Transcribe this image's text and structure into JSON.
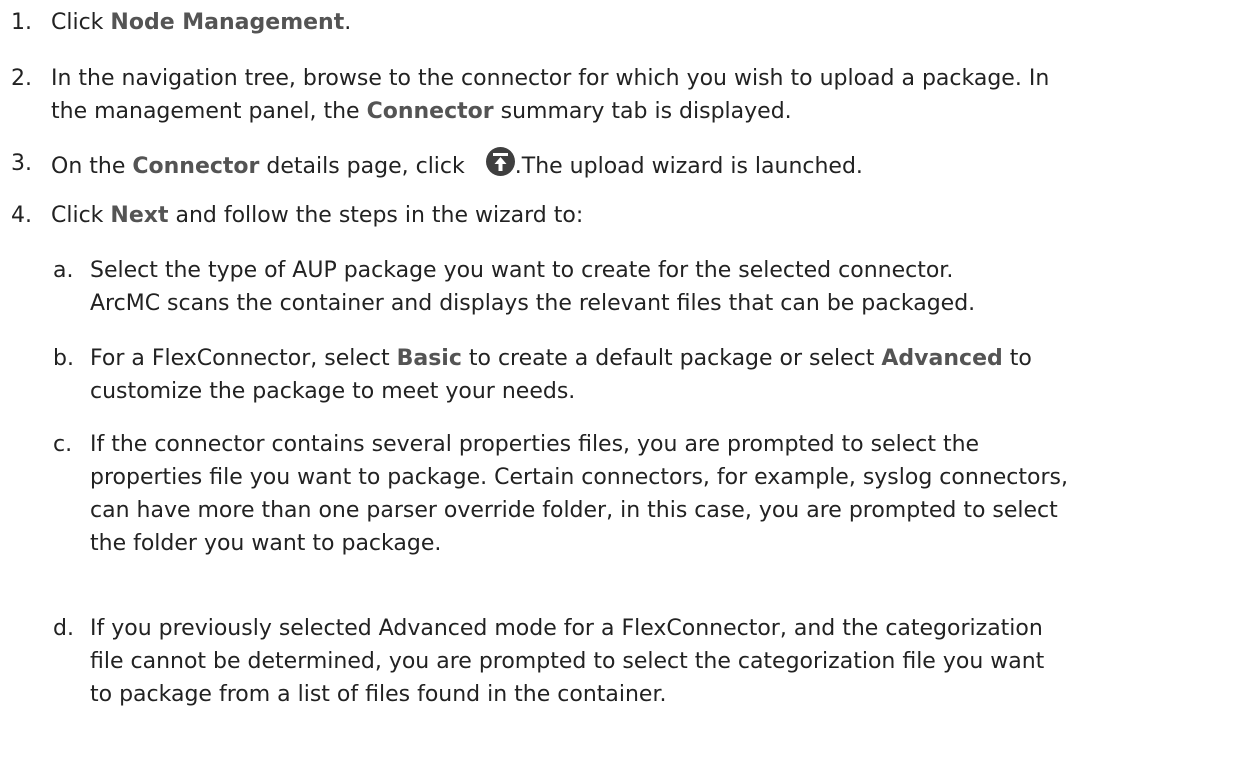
{
  "steps": [
    {
      "num": "1.",
      "pre": "Click ",
      "bold": "Node Management",
      "post": "."
    },
    {
      "num": "2.",
      "line1": "In the navigation tree, browse to the connector for which you wish to upload a package. In",
      "line2_pre": "the management panel, the ",
      "line2_bold": "Connector",
      "line2_post": " summary tab is displayed."
    },
    {
      "num": "3.",
      "pre": "On the ",
      "bold": "Connector",
      "mid": " details page, click ",
      "post": ".The upload wizard is launched.",
      "icon": "upload-icon"
    },
    {
      "num": "4.",
      "pre": "Click ",
      "bold": "Next",
      "post": " and follow the steps in the wizard to:"
    }
  ],
  "substeps": [
    {
      "num": "a.",
      "line1": "Select the type of AUP package you want to create for the selected connector.",
      "line2": "ArcMC scans the container and displays the relevant files that can be packaged."
    },
    {
      "num": "b.",
      "pre": "For a FlexConnector, select ",
      "bold1": "Basic",
      "mid": " to create a default package or select ",
      "bold2": "Advanced",
      "post": " to",
      "line2": "customize the package to meet your needs."
    },
    {
      "num": "c.",
      "line1": "If the connector contains several properties files, you are prompted to select the",
      "line2": "properties file you want to package. Certain connectors, for example, syslog connectors,",
      "line3": "can have more than one parser override folder, in this case, you are prompted to select",
      "line4": "the folder you want to package."
    },
    {
      "num": "d.",
      "line1": "If you previously selected Advanced mode for a FlexConnector, and the categorization",
      "line2": "file cannot be determined, you are prompted to select the categorization file you want",
      "line3": "to package from a list of files found in the container."
    }
  ],
  "colors": {
    "text": "#222222",
    "highlight": "#545454",
    "icon": "#3f3f3f"
  }
}
